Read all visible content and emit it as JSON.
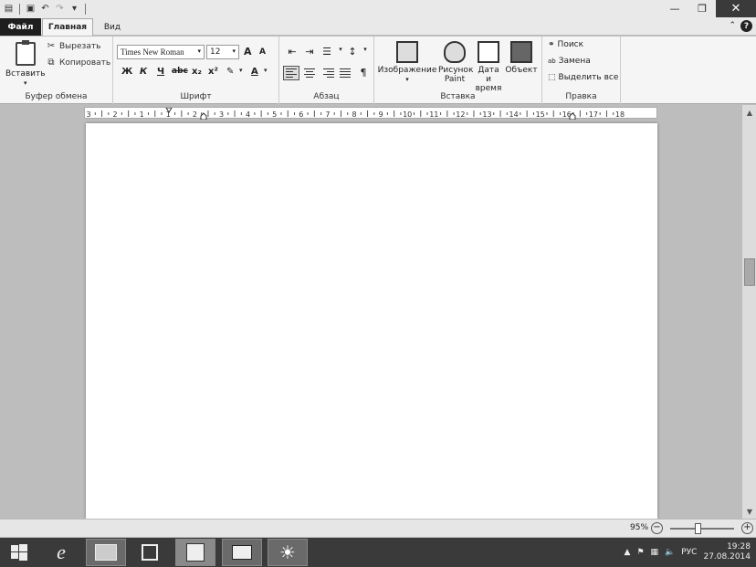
{
  "quick_access": {
    "icons": [
      "app-icon",
      "save-icon",
      "undo-icon",
      "redo-icon",
      "customize-icon"
    ]
  },
  "window_controls": {
    "minimize": "—",
    "restore": "❐",
    "close": "✕"
  },
  "tabs": {
    "file": "Файл",
    "home": "Главная",
    "view": "Вид"
  },
  "help": "?",
  "ribbon": {
    "clipboard": {
      "label": "Буфер обмена",
      "paste": "Вставить",
      "cut": "Вырезать",
      "copy": "Копировать"
    },
    "font": {
      "label": "Шрифт",
      "family": "Times New Roman",
      "size": "12",
      "grow": "A",
      "shrink": "A",
      "bold": "Ж",
      "italic": "К",
      "underline": "Ч",
      "strike": "abc",
      "subscript": "x₂",
      "superscript": "x²",
      "color": "A"
    },
    "paragraph": {
      "label": "Абзац"
    },
    "insert": {
      "label": "Вставка",
      "image": "Изображение",
      "paint": "Рисунок Paint",
      "datetime": "Дата и время",
      "object": "Объект"
    },
    "editing": {
      "label": "Правка",
      "find": "Поиск",
      "replace": "Замена",
      "select_all": "Выделить все"
    }
  },
  "ruler": {
    "ticks": [
      "3",
      "2",
      "1",
      "1",
      "2",
      "3",
      "4",
      "5",
      "6",
      "7",
      "8",
      "9",
      "10",
      "11",
      "12",
      "13",
      "14",
      "15",
      "16",
      "17",
      "18"
    ]
  },
  "status": {
    "zoom": "95%",
    "zoom_minus": "−",
    "zoom_plus": "+"
  },
  "taskbar": {
    "apps": [
      "start",
      "internet-explorer",
      "file-explorer",
      "store",
      "wordpad",
      "mail",
      "weather"
    ],
    "language": "РУС",
    "time": "19:28",
    "date": "27.08.2014"
  }
}
